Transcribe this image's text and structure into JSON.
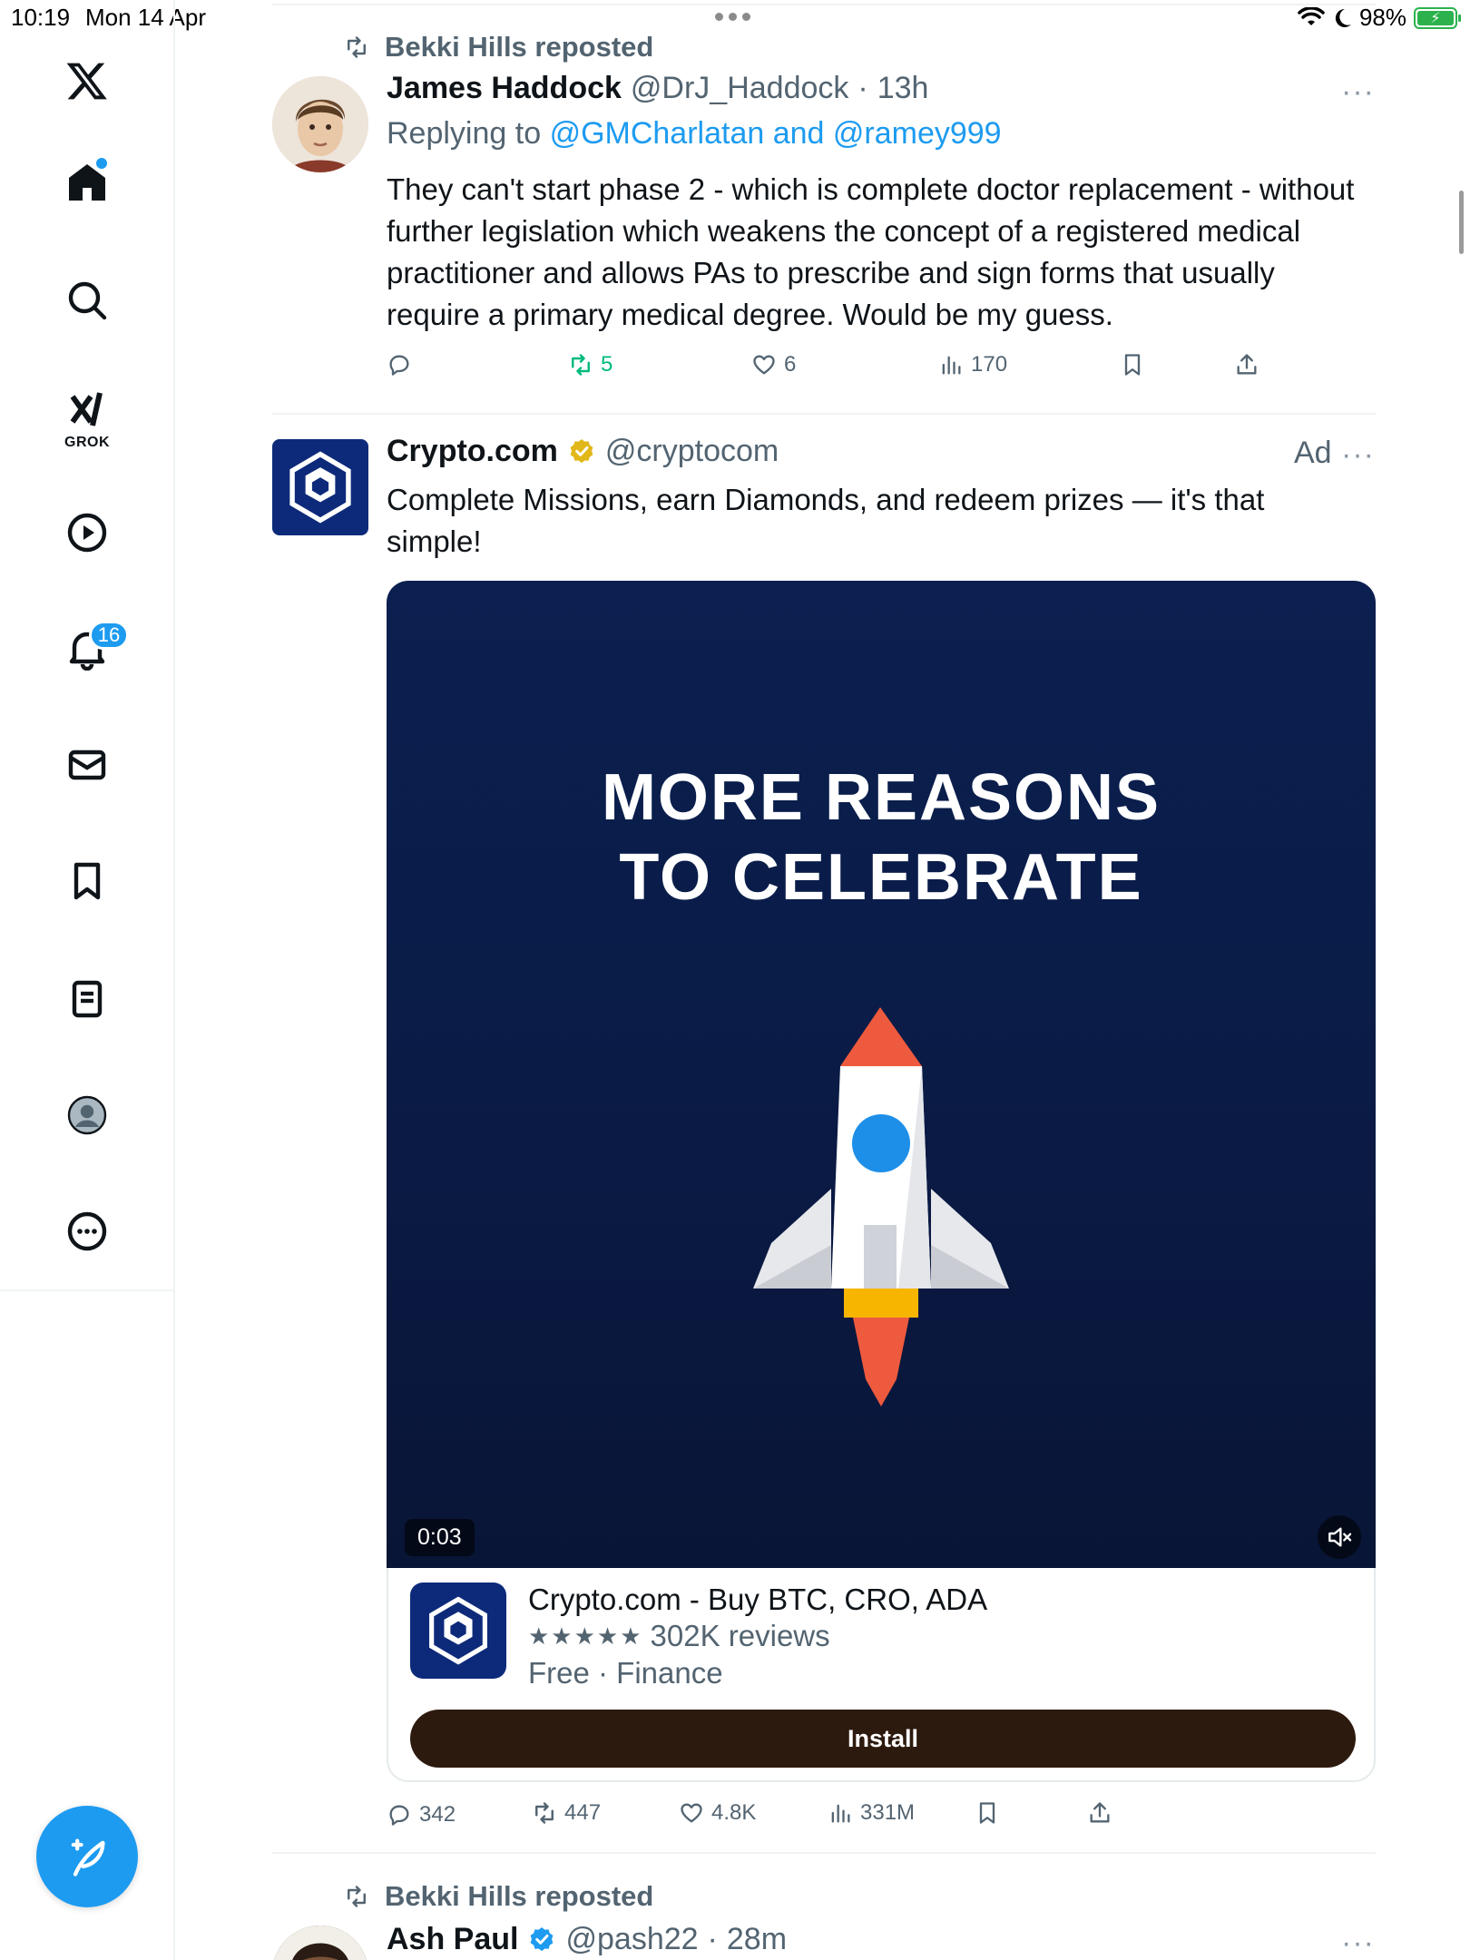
{
  "status_bar": {
    "time": "10:19",
    "date": "Mon 14 Apr",
    "battery": "98%"
  },
  "sidebar": {
    "grok_label": "GROK",
    "notification_count": "16"
  },
  "tweet1": {
    "repost_label": "Bekki Hills reposted",
    "name": "James Haddock",
    "handle": "@DrJ_Haddock",
    "dot": "·",
    "time": "13h",
    "reply_prefix": "Replying to",
    "reply_targets": "@GMCharlatan and @ramey999",
    "text": "They can't start phase 2 - which is complete doctor replacement - without further legislation which weakens the concept of a registered medical practitioner and allows PAs to prescribe and sign forms that usually require a primary medical degree. Would be my guess.",
    "retweets": "5",
    "likes": "6",
    "views": "170",
    "more": "···"
  },
  "tweet2": {
    "name": "Crypto.com",
    "handle": "@cryptocom",
    "ad_label": "Ad",
    "text": "Complete Missions, earn Diamonds, and redeem prizes — it's that simple!",
    "media_title_line1": "MORE REASONS",
    "media_title_line2": "TO CELEBRATE",
    "video_time": "0:03",
    "card_title": "Crypto.com - Buy BTC, CRO, ADA",
    "card_stars": "★★★★★",
    "card_reviews": "302K reviews",
    "card_meta": "Free · Finance",
    "install_label": "Install",
    "replies": "342",
    "retweets": "447",
    "likes": "4.8K",
    "views": "331M",
    "more": "···"
  },
  "tweet3": {
    "repost_label": "Bekki Hills reposted",
    "name": "Ash Paul",
    "handle": "@pash22",
    "dot": "·",
    "time": "28m",
    "more": "···"
  },
  "colors": {
    "accent": "#1d9bf0",
    "retweet_active": "#00ba7c",
    "install_bg": "#2d1a0e",
    "media_bg": "#0b2050"
  }
}
